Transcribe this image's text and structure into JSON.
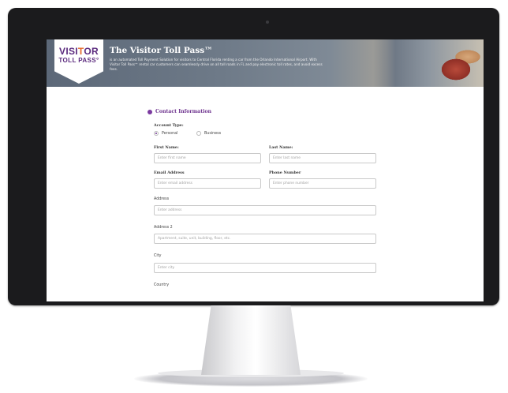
{
  "banner": {
    "logo_line1_a": "VISI",
    "logo_line1_b": "T",
    "logo_line1_c": "OR",
    "logo_line2": "TOLL PASS°",
    "title": "The Visitor Toll Pass™",
    "description": "is an automated Toll Payment Solution for visitors to Central Florida renting a car from the Orlando International Airport. With Visitor Toll Pass™ rental car customers can seamlessly drive on all toll roads in FL and pay electronic toll rates, and avoid excess fees."
  },
  "form": {
    "section_title": "Contact Information",
    "account_type_label": "Account Type:",
    "account_types": [
      {
        "label": "Personal",
        "selected": true
      },
      {
        "label": "Business",
        "selected": false
      }
    ],
    "first_name": {
      "label": "First Name:",
      "placeholder": "Enter first name"
    },
    "last_name": {
      "label": "Last Name:",
      "placeholder": "Enter last name"
    },
    "email": {
      "label": "Email Address",
      "placeholder": "Enter email address"
    },
    "phone": {
      "label": "Phone Number",
      "placeholder": "Enter phone number"
    },
    "address": {
      "label": "Address",
      "placeholder": "Enter address"
    },
    "address2": {
      "label": "Address 2",
      "placeholder": "Apartment, suite, unit, building, floor, etc."
    },
    "city": {
      "label": "City",
      "placeholder": "Enter city"
    },
    "country": {
      "label": "Country"
    }
  },
  "colors": {
    "accent": "#6b2f8c",
    "logo_orange": "#e46a2a",
    "bezel": "#1b1b1d"
  }
}
